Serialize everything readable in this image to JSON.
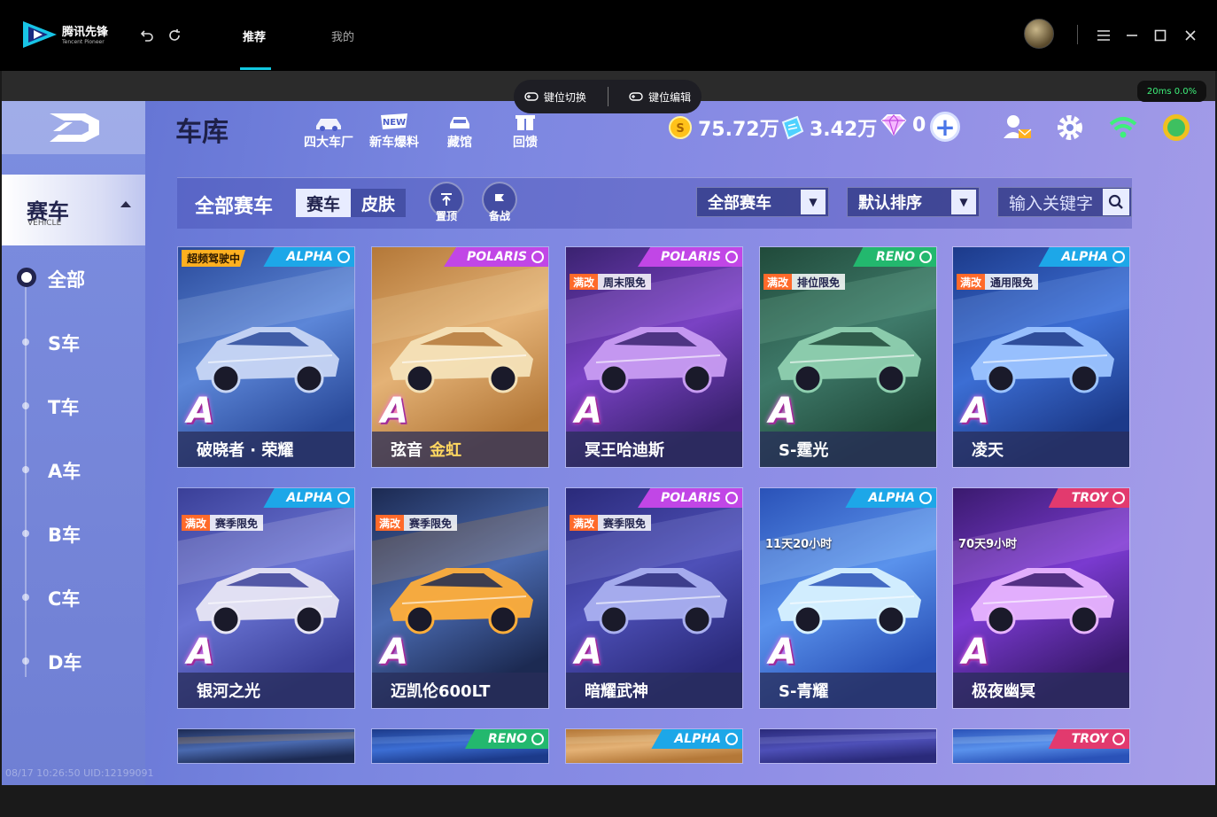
{
  "titlebar": {
    "brand_cn": "腾讯先锋",
    "brand_en": "Tencent Pioneer",
    "tabs": [
      {
        "label": "推荐",
        "active": true
      },
      {
        "label": "我的",
        "active": false
      }
    ],
    "accent": "#12c8e0"
  },
  "overlay": {
    "key_switch": "键位切换",
    "key_edit": "键位编辑",
    "ping": "20ms  0.0%"
  },
  "sidebar": {
    "section_title": "赛车",
    "section_sub": "VEHICLE",
    "items": [
      {
        "label": "全部",
        "active": true
      },
      {
        "label": "S车"
      },
      {
        "label": "T车"
      },
      {
        "label": "A车"
      },
      {
        "label": "B车"
      },
      {
        "label": "C车"
      },
      {
        "label": "D车"
      }
    ]
  },
  "header": {
    "title": "车库",
    "nav": [
      {
        "label": "四大车厂",
        "icon": "factory-car-icon"
      },
      {
        "label": "新车爆料",
        "icon": "new-badge-icon"
      },
      {
        "label": "藏馆",
        "icon": "garage-icon"
      },
      {
        "label": "回馈",
        "icon": "gift-icon"
      }
    ],
    "coins": "75.72万",
    "gems": "3.42万",
    "diamonds": "0"
  },
  "filter": {
    "all_label": "全部赛车",
    "seg": [
      "赛车",
      "皮肤"
    ],
    "pin_label": "置顶",
    "prepare_label": "备战",
    "dropdown1": "全部赛车",
    "dropdown2": "默认排序",
    "search_placeholder": "输入关键字"
  },
  "cars": [
    {
      "name": "破晓者 · 荣耀",
      "brand": "ALPHA",
      "badge": "超频驾驶中",
      "grade": "A",
      "theme": "alpha1"
    },
    {
      "name": "弦音",
      "name_gold": "金虹",
      "brand": "POLARIS",
      "grade": "A",
      "theme": "gold"
    },
    {
      "name": "冥王哈迪斯",
      "brand": "POLARIS",
      "mod": "满改",
      "free": "周末限免",
      "grade": "A",
      "theme": "purple"
    },
    {
      "name": "S-霆光",
      "brand": "RENO",
      "mod": "满改",
      "free": "排位限免",
      "grade": "A",
      "theme": "green"
    },
    {
      "name": "凌天",
      "brand": "ALPHA",
      "mod": "满改",
      "free": "通用限免",
      "grade": "A",
      "theme": "blue"
    },
    {
      "name": "银河之光",
      "brand": "ALPHA",
      "mod": "满改",
      "free": "赛季限免",
      "grade": "A",
      "theme": "red"
    },
    {
      "name": "迈凯伦600LT",
      "brand": "",
      "mod": "满改",
      "free": "赛季限免",
      "grade": "A",
      "theme": "orange"
    },
    {
      "name": "暗耀武神",
      "brand": "POLARIS",
      "mod": "满改",
      "free": "赛季限免",
      "grade": "A",
      "theme": "navy"
    },
    {
      "name": "S-青耀",
      "brand": "ALPHA",
      "timer": "11天20小时",
      "grade": "A",
      "theme": "ice"
    },
    {
      "name": "极夜幽冥",
      "brand": "TROY",
      "timer": "70天9小时",
      "grade": "A",
      "theme": "violet"
    }
  ],
  "partial_cards": [
    {
      "brand": "",
      "theme": "orange"
    },
    {
      "brand": "RENO",
      "theme": "blue"
    },
    {
      "brand": "ALPHA",
      "theme": "gold"
    },
    {
      "brand": "",
      "theme": "navy"
    },
    {
      "brand": "TROY",
      "theme": "ice"
    }
  ],
  "watermark": "08/17 10:26:50 UID:12199091"
}
